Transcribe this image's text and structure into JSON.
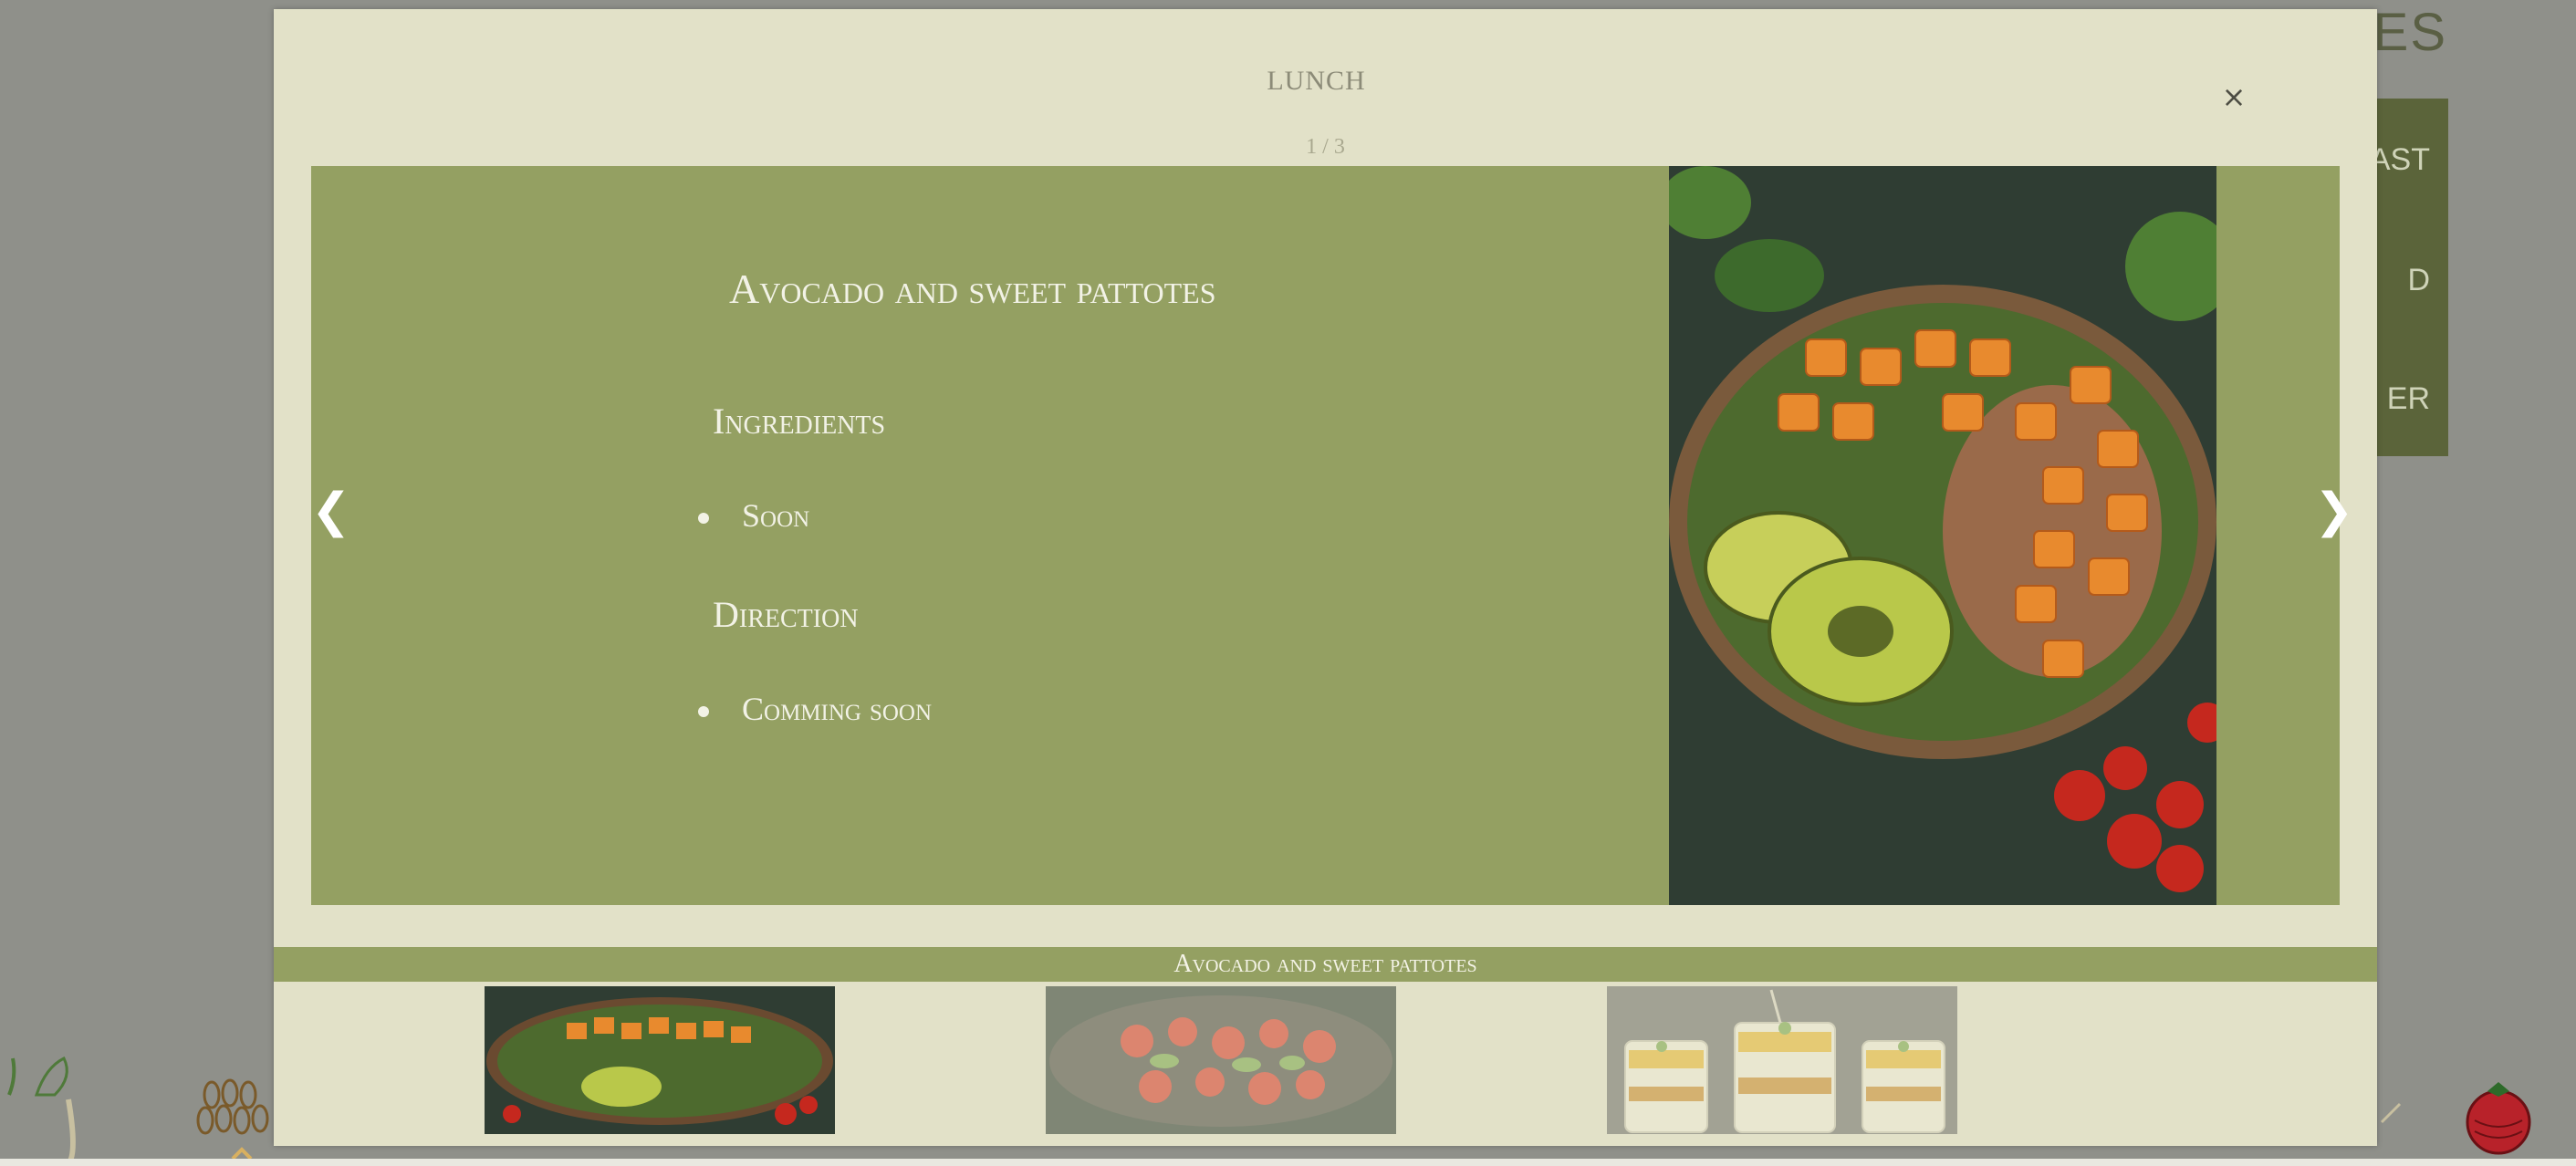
{
  "background": {
    "title_fragment": "PES",
    "nav_fragments": [
      "FAST",
      "D",
      "ER"
    ]
  },
  "modal": {
    "title": "LUNCH",
    "close_label": "×",
    "counter": "1 / 3",
    "prev_label": "❮",
    "next_label": "❯",
    "caption": "Avocado and sweet pattotes"
  },
  "recipe": {
    "title": "Avocado and sweet pattotes",
    "ingredients_heading": "Ingredients",
    "ingredients": [
      "Soon"
    ],
    "direction_heading": "Direction",
    "directions": [
      "Comming soon"
    ]
  },
  "thumbnails": [
    {
      "icon": "avocado-sweet-potato-bowl-image",
      "active": true
    },
    {
      "icon": "tomato-salad-image",
      "active": false
    },
    {
      "icon": "fruit-parfait-image",
      "active": false
    }
  ],
  "colors": {
    "modal_bg": "#e2e1c8",
    "slide_bg": "#94a062",
    "accent_dark": "#5b643a",
    "page_bg": "#8f908a"
  }
}
